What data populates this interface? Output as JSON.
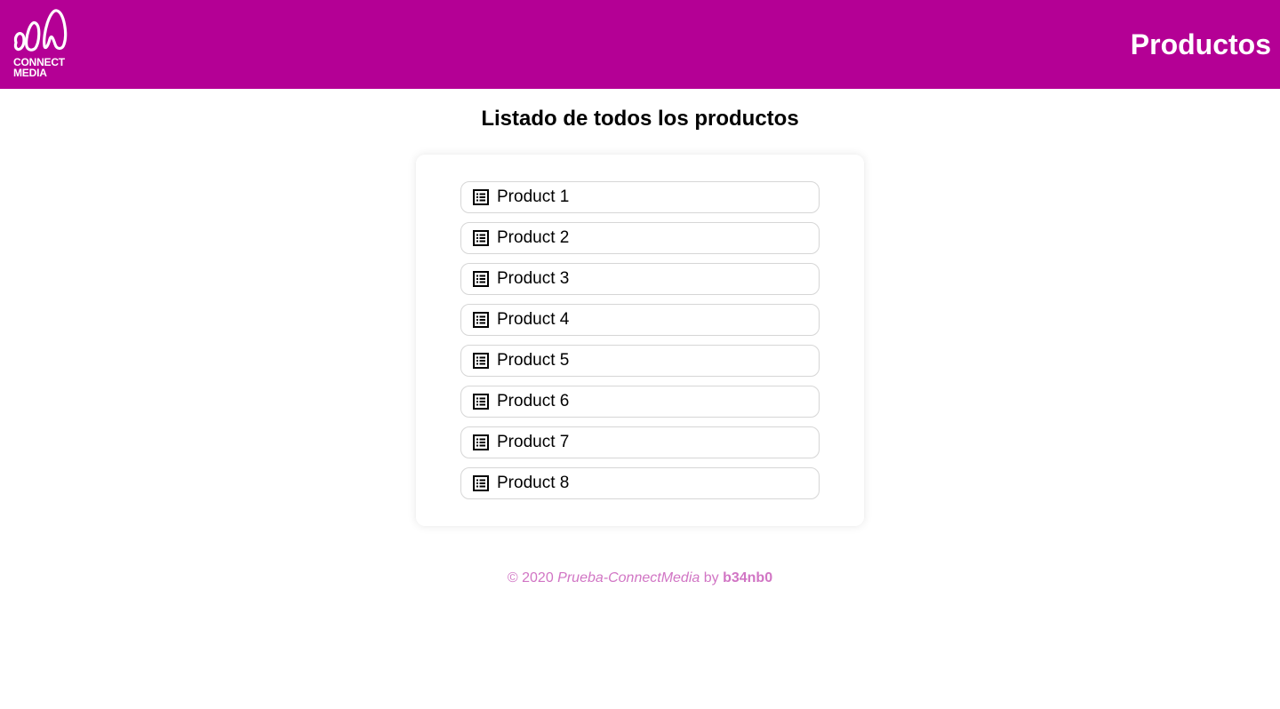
{
  "header": {
    "logo_line1": "CONNECT",
    "logo_line2": "MEDIA",
    "title": "Productos"
  },
  "main": {
    "heading": "Listado de todos los productos",
    "products": [
      {
        "label": "Product 1",
        "icon": "list-alt-icon"
      },
      {
        "label": "Product 2",
        "icon": "list-alt-icon"
      },
      {
        "label": "Product 3",
        "icon": "list-alt-icon"
      },
      {
        "label": "Product 4",
        "icon": "list-alt-icon"
      },
      {
        "label": "Product 5",
        "icon": "list-alt-icon"
      },
      {
        "label": "Product 6",
        "icon": "list-alt-icon"
      },
      {
        "label": "Product 7",
        "icon": "list-alt-icon"
      },
      {
        "label": "Product 8",
        "icon": "list-alt-icon"
      }
    ]
  },
  "footer": {
    "copyright": "© 2020",
    "project": "Prueba-ConnectMedia",
    "by": "by",
    "author": "b34nb0"
  },
  "colors": {
    "brand": "#b40095",
    "footer_text": "#d175c4",
    "item_border": "#d6d6d6"
  }
}
